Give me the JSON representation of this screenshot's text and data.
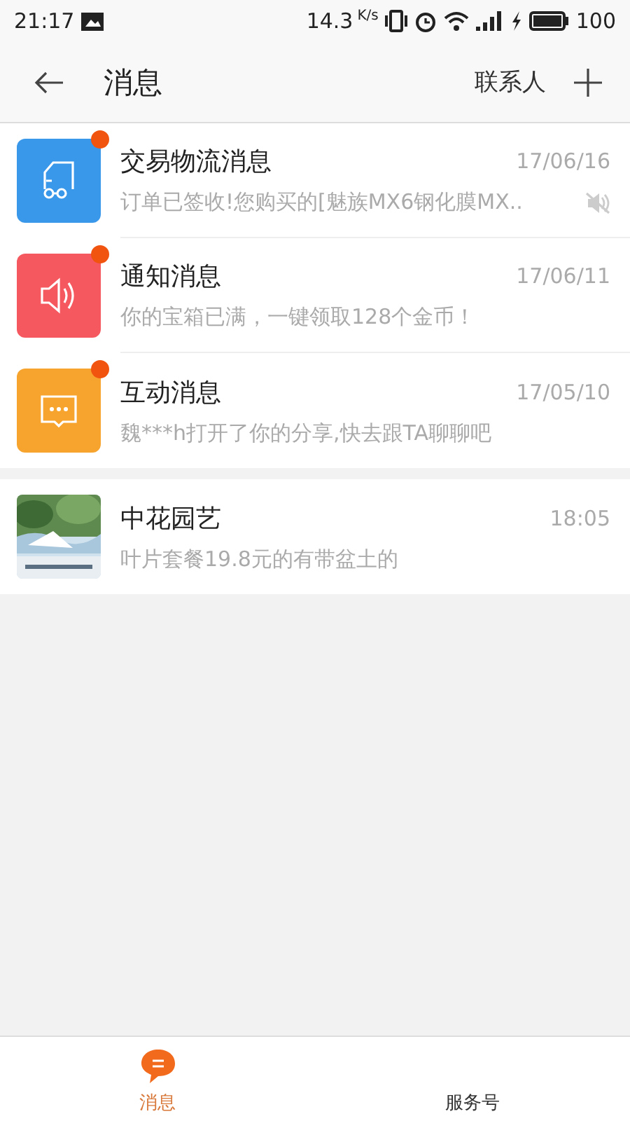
{
  "status_bar": {
    "time": "21:17",
    "speed": "14.3",
    "speed_unit": "K/s",
    "battery": "100"
  },
  "header": {
    "title": "消息",
    "contacts_link": "联系人"
  },
  "sections": [
    {
      "items": [
        {
          "kind": "truck",
          "color": "#3a98ea",
          "title": "交易物流消息",
          "time": "17/06/16",
          "preview": "订单已签收!您购买的[魅族MX6钢化膜MX..",
          "unread": true,
          "muted": true
        },
        {
          "kind": "speaker",
          "color": "#f5585f",
          "title": "通知消息",
          "time": "17/06/11",
          "preview": "你的宝箱已满，一键领取128个金币！",
          "unread": true,
          "muted": false
        },
        {
          "kind": "chat",
          "color": "#f7a42e",
          "title": "互动消息",
          "time": "17/05/10",
          "preview": "魏***h打开了你的分享,快去跟TA聊聊吧",
          "unread": true,
          "muted": false
        }
      ]
    },
    {
      "items": [
        {
          "kind": "picture",
          "title": "中花园艺",
          "time": "18:05",
          "preview": "叶片套餐19.8元的有带盆土的",
          "unread": false,
          "muted": false
        }
      ]
    }
  ],
  "tabs": [
    {
      "label": "消息",
      "selected": true
    },
    {
      "label": "服务号",
      "selected": false
    }
  ]
}
